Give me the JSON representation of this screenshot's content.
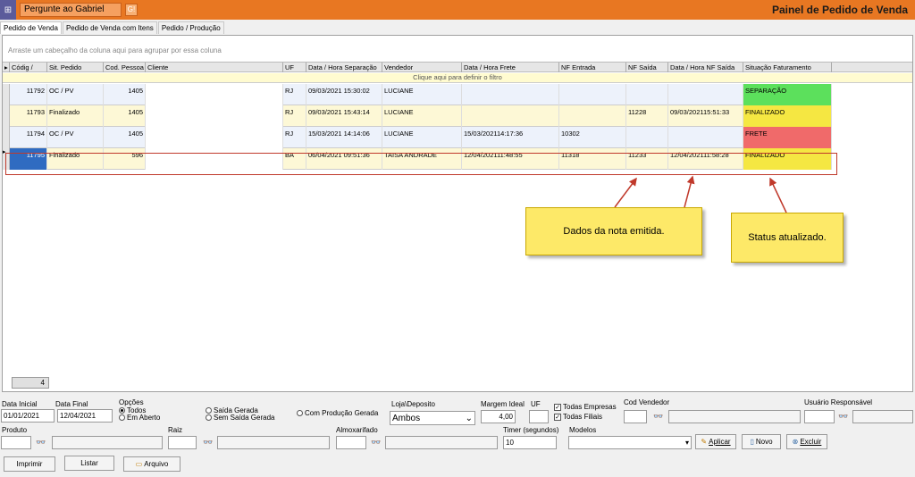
{
  "app": {
    "search_label": "Pergunte ao Gabriel",
    "search_btn": "G!",
    "title": "Painel de Pedido de Venda"
  },
  "tabs": [
    {
      "label": "Pedido de Venda"
    },
    {
      "label": "Pedido de Venda com Itens"
    },
    {
      "label": "Pedido / Produção"
    }
  ],
  "grid": {
    "group_hint": "Arraste um cabeçalho da coluna aqui para agrupar por essa coluna",
    "filter_hint": "Clique aqui para definir o filtro",
    "headers": [
      "Códig /",
      "Sit. Pedido",
      "Cod. Pessoa",
      "Cliente",
      "UF",
      "Data / Hora Separação",
      "Vendedor",
      "Data / Hora Frete",
      "NF Entrada",
      "NF Saída",
      "Data / Hora NF Saída",
      "Situação Faturamento"
    ],
    "rows": [
      {
        "codigo": "11792",
        "sit": "OC / PV",
        "pessoa": "1405",
        "cliente": "",
        "uf": "RJ",
        "sep": "09/03/2021 15:30:02",
        "vendedor": "LUCIANE",
        "frete": "",
        "nfe": "",
        "nfs": "",
        "nfs_dt": "",
        "status": "SEPARAÇÃO",
        "status_color": "#5ce05c"
      },
      {
        "codigo": "11793",
        "sit": "Finalizado",
        "pessoa": "1405",
        "cliente": "",
        "uf": "RJ",
        "sep": "09/03/2021 15:43:14",
        "vendedor": "LUCIANE",
        "frete": "",
        "nfe": "",
        "nfs": "11228",
        "nfs_dt": "09/03/202115:51:33",
        "status": "FINALIZADO",
        "status_color": "#f5e742"
      },
      {
        "codigo": "11794",
        "sit": "OC / PV",
        "pessoa": "1405",
        "cliente": "",
        "uf": "RJ",
        "sep": "15/03/2021 14:14:06",
        "vendedor": "LUCIANE",
        "frete": "15/03/202114:17:36",
        "nfe": "10302",
        "nfs": "",
        "nfs_dt": "",
        "status": "FRETE",
        "status_color": "#f06a6a"
      },
      {
        "codigo": "11795",
        "sit": "Finalizado",
        "pessoa": "596",
        "cliente": "",
        "uf": "BA",
        "sep": "06/04/2021 09:51:36",
        "vendedor": "TAISA ANDRADE",
        "frete": "12/04/202111:48:55",
        "nfe": "11318",
        "nfs": "11233",
        "nfs_dt": "12/04/202111:58:28",
        "status": "FINALIZADO",
        "status_color": "#f5e742"
      }
    ],
    "count": "4"
  },
  "notes": {
    "nota": "Dados da nota emitida.",
    "status": "Status atualizado."
  },
  "filters": {
    "data_inicial_label": "Data Inicial",
    "data_inicial": "01/01/2021",
    "data_final_label": "Data Final",
    "data_final": "12/04/2021",
    "opcoes_label": "Opções",
    "opt_todos": "Todos",
    "opt_aberto": "Em Aberto",
    "opt_saida": "Saída Gerada",
    "opt_sem_saida": "Sem Saída Gerada",
    "opt_producao": "Com Produção Gerada",
    "loja_label": "Loja\\Deposito",
    "loja_value": "Ambos",
    "margem_label": "Margem Ideal",
    "margem_value": "4,00",
    "uf_label": "UF",
    "todas_empresas": "Todas Empresas",
    "todas_filiais": "Todas Filiais",
    "cod_vendedor_label": "Cod Vendedor",
    "usuario_label": "Usuário Responsável",
    "produto_label": "Produto",
    "raiz_label": "Raiz",
    "almox_label": "Almoxarifado",
    "timer_label": "Timer (segundos)",
    "timer_value": "10",
    "modelos_label": "Modelos"
  },
  "buttons": {
    "aplicar": "Aplicar",
    "novo": "Novo",
    "excluir": "Excluir",
    "imprimir": "Imprimir",
    "listar": "Listar",
    "arquivo": "Arquivo"
  }
}
